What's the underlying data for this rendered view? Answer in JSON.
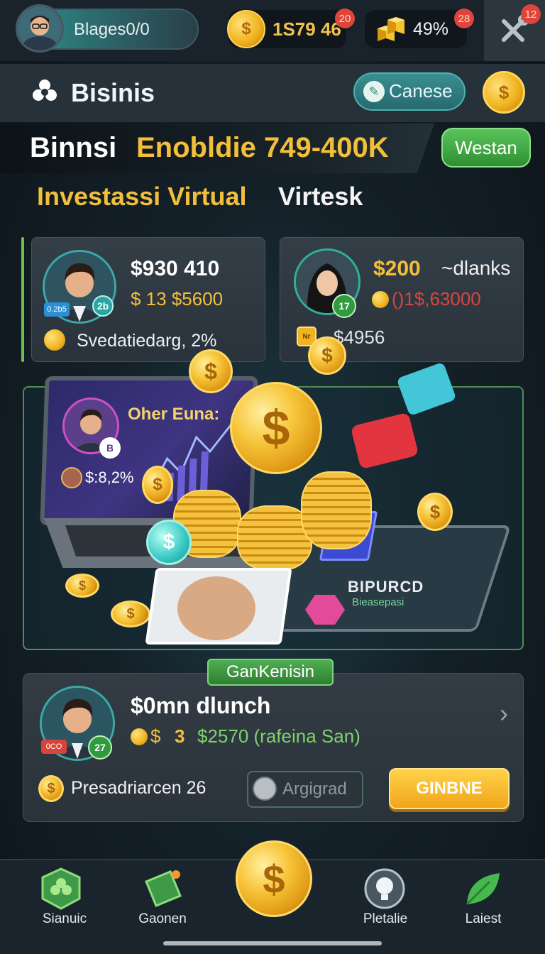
{
  "topbar": {
    "player_name": "Blages0/0",
    "coin_value": "1S79 46",
    "coin_badge": "20",
    "gold_value": "49%",
    "gold_badge": "28",
    "tool_badge": "12"
  },
  "header": {
    "title": "Bisinis",
    "canese_label": "Canese"
  },
  "banner": {
    "white_text": "Binnsi",
    "gold_text": "Enobldie 749-400K",
    "westan_label": "Westan"
  },
  "subtitle": {
    "gold": "Investassi Virtual",
    "white": "Virtesk"
  },
  "card_left": {
    "badge_small": "0.2b5",
    "badge_round": "2b",
    "amount": "$930 410",
    "stat": "$ 13 $5600",
    "footer": "Svedatiedarg, 2%"
  },
  "card_right": {
    "badge_round": "17",
    "amount_gold": "$200",
    "amount_white": "~dlanks",
    "stat": "()1$,63000",
    "ticket": "Nr",
    "footer": "$4956"
  },
  "illustration": {
    "screen_title": "Oher Euna:",
    "screen_stat": "$:8,2%",
    "screen_badge": "B",
    "tablet_title": "BIPURCD",
    "tablet_sub": "Bieasepasi"
  },
  "bottom_card": {
    "tag": "GanKenisin",
    "badge_small": "0CO",
    "badge_round": "27",
    "amount": "$0mn dlunch",
    "stat_num": "3",
    "stat_val": "$2570  (rafeina San)",
    "footer": "Presadriarcen 26",
    "argi_label": "Argigrad",
    "gin_label": "GINBNE"
  },
  "nav": {
    "items": [
      {
        "label": "Sianuic",
        "icon": "clover-shield-icon"
      },
      {
        "label": "Gaonen",
        "icon": "green-ticket-icon"
      },
      {
        "label": "",
        "icon": "dollar-coin-icon"
      },
      {
        "label": "Pletalie",
        "icon": "lightbulb-icon"
      },
      {
        "label": "Laiest",
        "icon": "leaf-icon"
      }
    ]
  },
  "colors": {
    "gold": "#f2bf3a",
    "green": "#4fae52",
    "teal": "#3a8f92",
    "red_stat": "#d8453f",
    "background": "#142028"
  }
}
